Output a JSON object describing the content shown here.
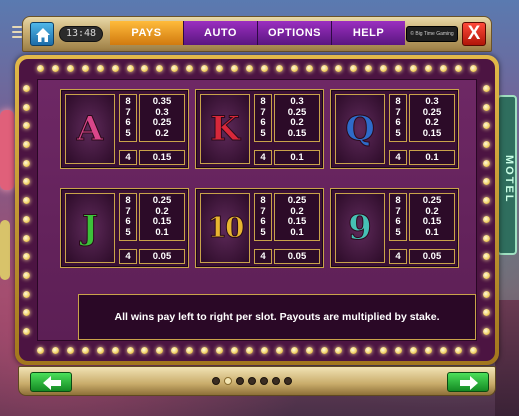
{
  "header": {
    "time": "13:48",
    "tabs": [
      {
        "label": "PAYS",
        "active": true
      },
      {
        "label": "AUTO",
        "active": false
      },
      {
        "label": "OPTIONS",
        "active": false
      },
      {
        "label": "HELP",
        "active": false
      }
    ],
    "brand": "© Big Time Gaming",
    "close_label": "X"
  },
  "background": {
    "sign_text": "MOTEL"
  },
  "paytable": [
    {
      "symbol": "A",
      "color": "#d9468a",
      "counts": [
        "8",
        "7",
        "6",
        "5"
      ],
      "pays": [
        "0.35",
        "0.3",
        "0.25",
        "0.2"
      ],
      "count4": "4",
      "pay4": "0.15"
    },
    {
      "symbol": "K",
      "color": "#d8283a",
      "counts": [
        "8",
        "7",
        "6",
        "5"
      ],
      "pays": [
        "0.3",
        "0.25",
        "0.2",
        "0.15"
      ],
      "count4": "4",
      "pay4": "0.1"
    },
    {
      "symbol": "Q",
      "color": "#2e6bc9",
      "counts": [
        "8",
        "7",
        "6",
        "5"
      ],
      "pays": [
        "0.3",
        "0.25",
        "0.2",
        "0.15"
      ],
      "count4": "4",
      "pay4": "0.1"
    },
    {
      "symbol": "J",
      "color": "#3cc23a",
      "counts": [
        "8",
        "7",
        "6",
        "5"
      ],
      "pays": [
        "0.25",
        "0.2",
        "0.15",
        "0.1"
      ],
      "count4": "4",
      "pay4": "0.05"
    },
    {
      "symbol": "10",
      "color": "#e8b530",
      "counts": [
        "8",
        "7",
        "6",
        "5"
      ],
      "pays": [
        "0.25",
        "0.2",
        "0.15",
        "0.1"
      ],
      "count4": "4",
      "pay4": "0.05"
    },
    {
      "symbol": "9",
      "color": "#46c0b4",
      "counts": [
        "8",
        "7",
        "6",
        "5"
      ],
      "pays": [
        "0.25",
        "0.2",
        "0.15",
        "0.1"
      ],
      "count4": "4",
      "pay4": "0.05"
    }
  ],
  "note": "All wins pay left to right per slot. Payouts are multiplied by stake.",
  "pagination": {
    "pages": 7,
    "current": 2
  },
  "icons": {
    "menu": "hamburger-icon",
    "home": "home-icon",
    "close": "close-icon",
    "prev": "arrow-left-icon",
    "next": "arrow-right-icon"
  }
}
